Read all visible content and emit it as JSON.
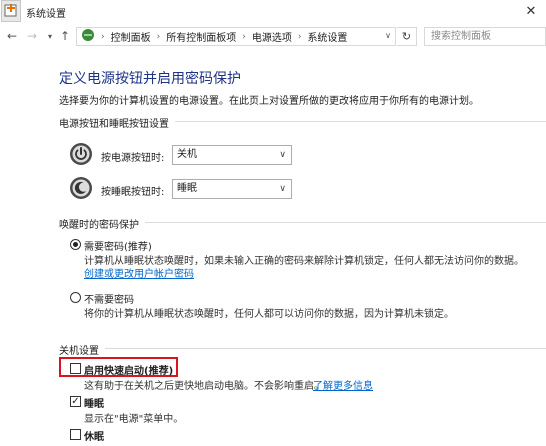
{
  "window": {
    "title": "系统设置"
  },
  "nav": {
    "breadcrumb": [
      "控制面板",
      "所有控制面板项",
      "电源选项",
      "系统设置"
    ],
    "search_placeholder": "搜索控制面板"
  },
  "page": {
    "title": "定义电源按钮并启用密码保护",
    "description": "选择要为你的计算机设置的电源设置。在此页上对设置所做的更改将应用于你所有的电源计划。"
  },
  "buttons_section": {
    "title": "电源按钮和睡眠按钮设置",
    "power": {
      "label": "按电源按钮时:",
      "value": "关机"
    },
    "sleep": {
      "label": "按睡眠按钮时:",
      "value": "睡眠"
    }
  },
  "password_section": {
    "title": "唤醒时的密码保护",
    "require": {
      "label": "需要密码(推荐)",
      "selected": true,
      "desc": "计算机从睡眠状态唤醒时，如果未输入正确的密码来解除计算机锁定，任何人都无法访问你的数据。",
      "link": "创建或更改用户帐户密码"
    },
    "no_require": {
      "label": "不需要密码",
      "selected": false,
      "desc": "将你的计算机从睡眠状态唤醒时，任何人都可以访问你的数据，因为计算机未锁定。"
    }
  },
  "shutdown_section": {
    "title": "关机设置",
    "fast_startup": {
      "label": "启用快速启动(推荐)",
      "checked": false,
      "desc": "这有助于在关机之后更快地启动电脑。不会影响重启。",
      "link": "了解更多信息"
    },
    "sleep": {
      "label": "睡眠",
      "checked": true,
      "desc": "显示在\"电源\"菜单中。"
    },
    "hibernate": {
      "label": "休眠",
      "checked": false
    }
  }
}
